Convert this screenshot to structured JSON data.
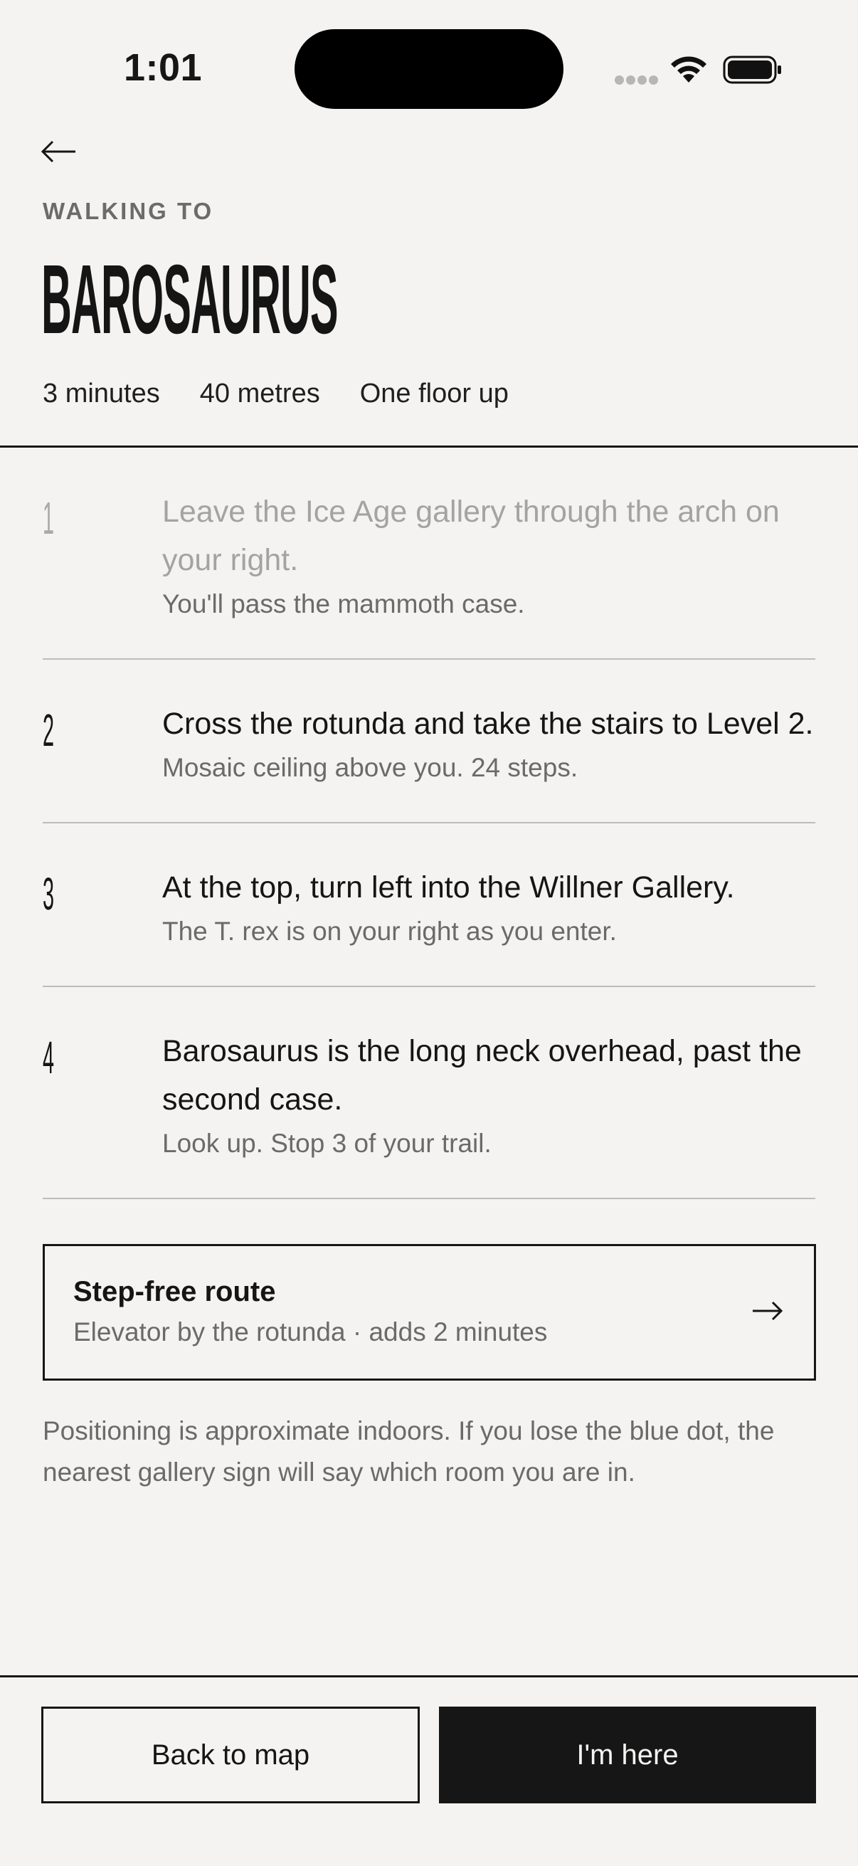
{
  "status_bar": {
    "time": "1:01",
    "icons": [
      "cellular-signal-icon",
      "wifi-icon",
      "battery-icon"
    ]
  },
  "header": {
    "back_icon": "back-arrow-icon",
    "eyebrow": "WALKING TO",
    "title": "BAROSAURUS",
    "meta": [
      "3 minutes",
      "40 metres",
      "One floor up"
    ]
  },
  "steps": [
    {
      "number": "1",
      "text": "Leave the Ice Age gallery through the arch on your right.",
      "sub": "You'll pass the mammoth case.",
      "state": "completed"
    },
    {
      "number": "2",
      "text": "Cross the rotunda and take the stairs to Level 2.",
      "sub": "Mosaic ceiling above you. 24 steps.",
      "state": "current"
    },
    {
      "number": "3",
      "text": "At the top, turn left into the Willner Gallery.",
      "sub": "The T. rex is on your right as you enter.",
      "state": "upcoming"
    },
    {
      "number": "4",
      "text": "Barosaurus is the long neck overhead, past the second case.",
      "sub": "Look up. Stop 3 of your trail.",
      "state": "upcoming"
    }
  ],
  "step_free": {
    "title": "Step-free route",
    "subtitle": "Elevator by the rotunda · adds 2 minutes",
    "icon": "arrow-right-icon"
  },
  "note": "Positioning is approximate indoors. If you lose the blue dot, the nearest gallery sign will say which room you are in.",
  "actions": {
    "back_to_map": "Back to map",
    "im_here": "I'm here"
  },
  "colors": {
    "background": "#f4f3f1",
    "ink": "#161616",
    "muted": "#6b6a67",
    "dim": "#a4a3a0",
    "divider": "#bdbcb9"
  }
}
